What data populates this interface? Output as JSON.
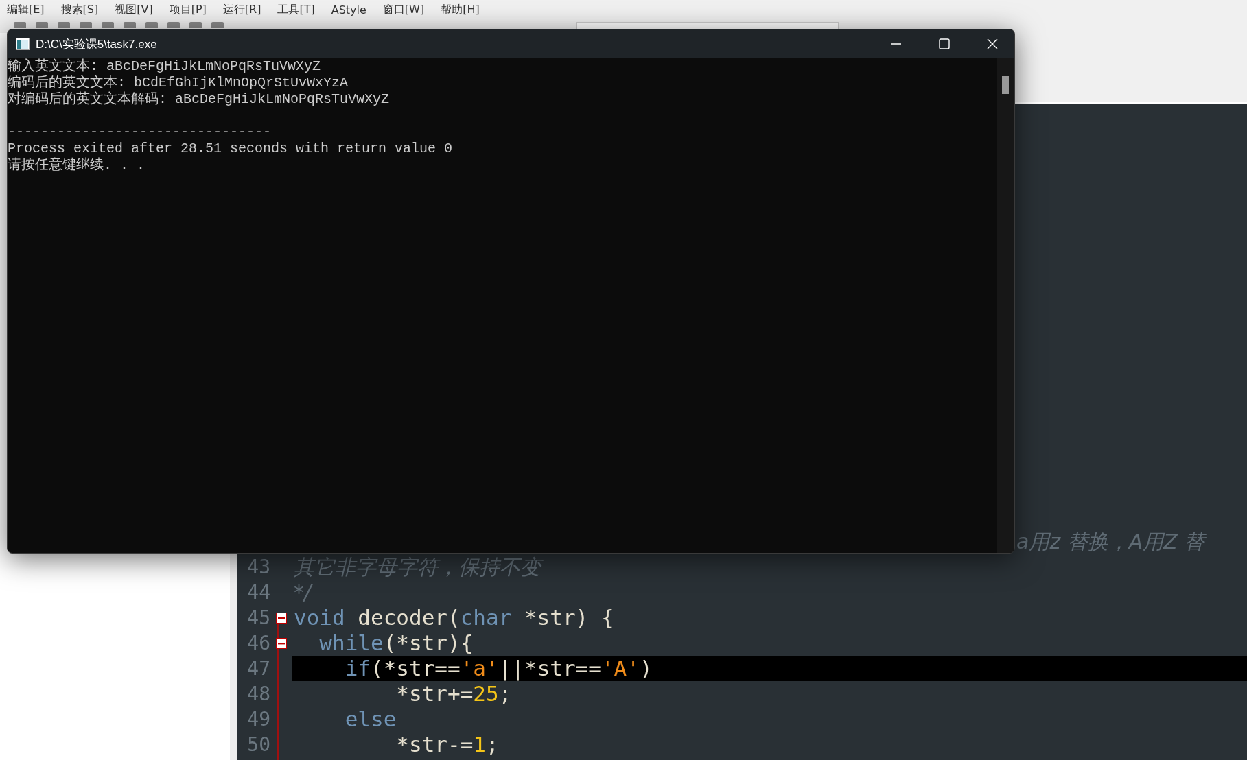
{
  "menu_bar": {
    "items": [
      "编辑[E]",
      "搜索[S]",
      "视图[V]",
      "项目[P]",
      "运行[R]",
      "工具[T]",
      "AStyle",
      "窗口[W]",
      "帮助[H]"
    ]
  },
  "editor": {
    "lines": [
      {
        "tokens": [
          {
            "kind": "comment",
            "text": "a用z 替换，A用Z 替"
          }
        ]
      },
      {
        "number": "43",
        "tokens": [
          {
            "kind": "comment",
            "text": "其它非字母字符，保持不变"
          }
        ]
      },
      {
        "number": "44",
        "tokens": [
          {
            "kind": "comment",
            "text": "*/"
          }
        ]
      },
      {
        "number": "45",
        "fold": true,
        "tokens": [
          {
            "kind": "keyword",
            "text": "void"
          },
          {
            "kind": "plain",
            "text": " decoder("
          },
          {
            "kind": "keyword",
            "text": "char"
          },
          {
            "kind": "plain",
            "text": " *str) {"
          }
        ]
      },
      {
        "number": "46",
        "fold": true,
        "tokens": [
          {
            "kind": "keyword",
            "text": "  while"
          },
          {
            "kind": "plain",
            "text": "(*str){"
          }
        ]
      },
      {
        "number": "47",
        "current": true,
        "tokens": [
          {
            "kind": "keyword",
            "text": "    if"
          },
          {
            "kind": "plain",
            "text": "(*str=="
          },
          {
            "kind": "string",
            "text": "'a'"
          },
          {
            "kind": "plain",
            "text": "||*str=="
          },
          {
            "kind": "string",
            "text": "'A'"
          },
          {
            "kind": "plain",
            "text": ")"
          }
        ]
      },
      {
        "number": "48",
        "tokens": [
          {
            "kind": "plain",
            "text": "        *str+="
          },
          {
            "kind": "number",
            "text": "25"
          },
          {
            "kind": "plain",
            "text": ";"
          }
        ]
      },
      {
        "number": "49",
        "tokens": [
          {
            "kind": "keyword",
            "text": "    else"
          }
        ]
      },
      {
        "number": "50",
        "tokens": [
          {
            "kind": "plain",
            "text": "        *str-="
          },
          {
            "kind": "number",
            "text": "1"
          },
          {
            "kind": "plain",
            "text": ";"
          }
        ]
      }
    ]
  },
  "console": {
    "title": "D:\\C\\实验课5\\task7.exe",
    "lines": [
      "输入英文文本: aBcDeFgHiJkLmNoPqRsTuVwXyZ",
      "编码后的英文文本: bCdEfGhIjKlMnOpQrStUvWxYzA",
      "对编码后的英文文本解码: aBcDeFgHiJkLmNoPqRsTuVwXyZ"
    ],
    "separator": "--------------------------------",
    "footer_lines": [
      "Process exited after 28.51 seconds with return value 0",
      "请按任意键继续. . ."
    ]
  }
}
